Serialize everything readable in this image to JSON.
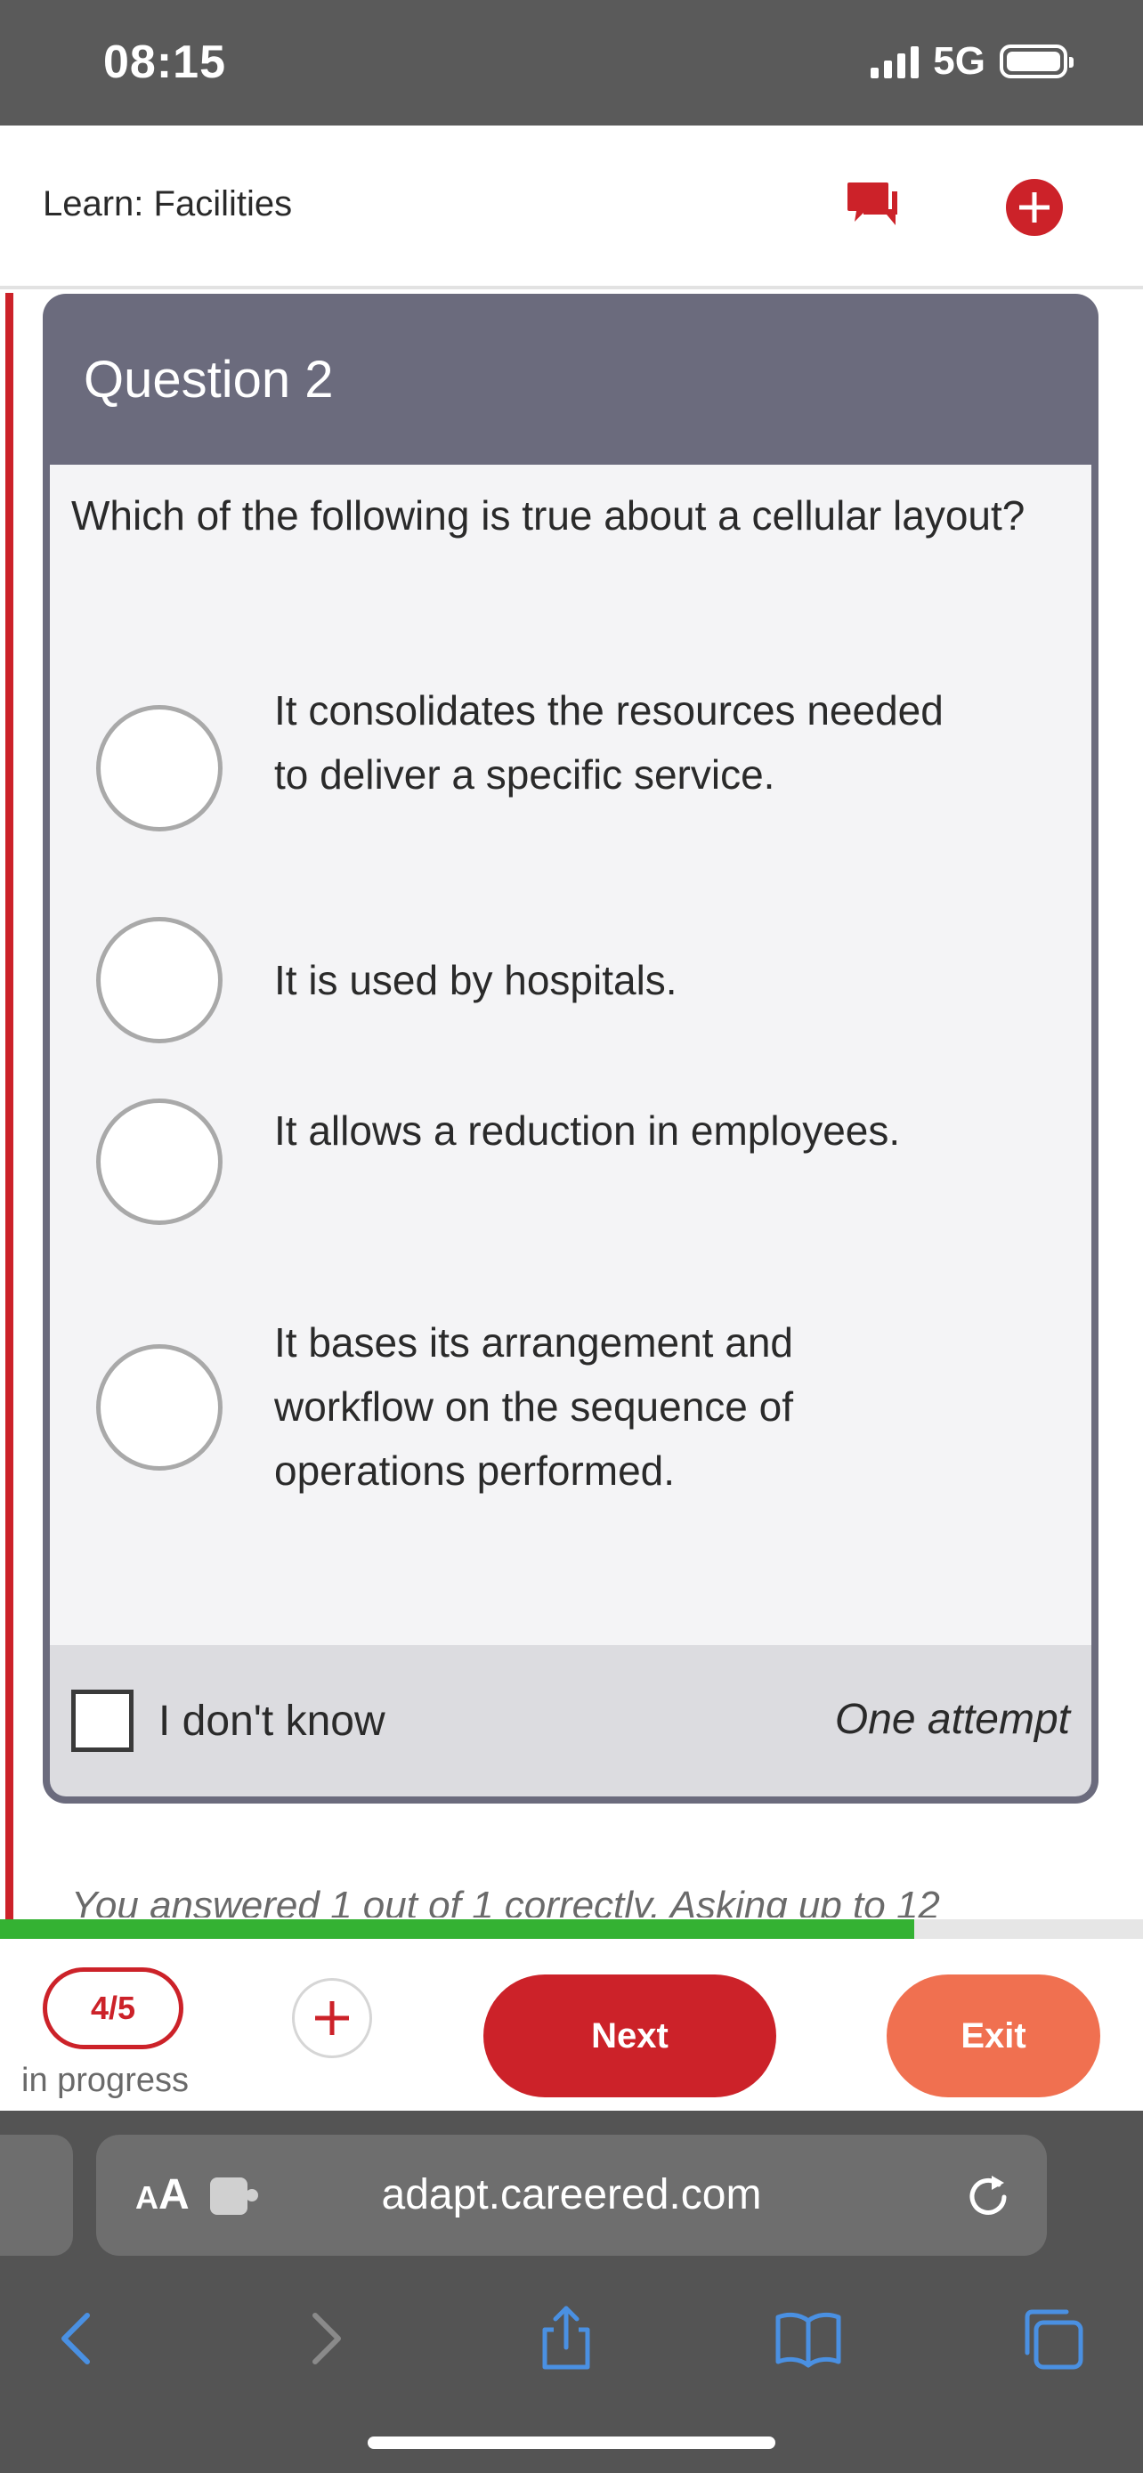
{
  "status_bar": {
    "time": "08:15",
    "network": "5G"
  },
  "header": {
    "title": "Learn: Facilities"
  },
  "icons": {
    "chat": "chat-bubbles-icon",
    "add": "plus-circle-icon",
    "back": "chevron-left-icon",
    "forward": "chevron-right-icon",
    "share": "share-icon",
    "bookmarks": "book-icon",
    "tabs": "tabs-icon",
    "reload": "reload-icon",
    "extension": "puzzle-icon"
  },
  "colors": {
    "brand_red": "#cc2229",
    "exit_orange": "#f07050",
    "progress_green": "#34b233",
    "card_header": "#6b6b7d"
  },
  "question": {
    "title": "Question 2",
    "text": "Which of the following is true about a cellular layout?",
    "options": [
      "It consolidates the resources needed to deliver a specific service.",
      "It is used by hospitals.",
      "It allows a reduction in employees.",
      "It bases its arrangement and workflow on the sequence of operations performed."
    ],
    "dont_know_label": "I don't know",
    "attempts": "One attempt"
  },
  "feedback_text": "You answered 1 out of 1 correctly. Asking up to 12",
  "progress": {
    "fraction": 0.8
  },
  "bottom_nav": {
    "count": "4/5",
    "status": "in progress",
    "next_label": "Next",
    "exit_label": "Exit"
  },
  "browser": {
    "aa_small": "A",
    "aa_big": "A",
    "url": "adapt.careered.com"
  }
}
